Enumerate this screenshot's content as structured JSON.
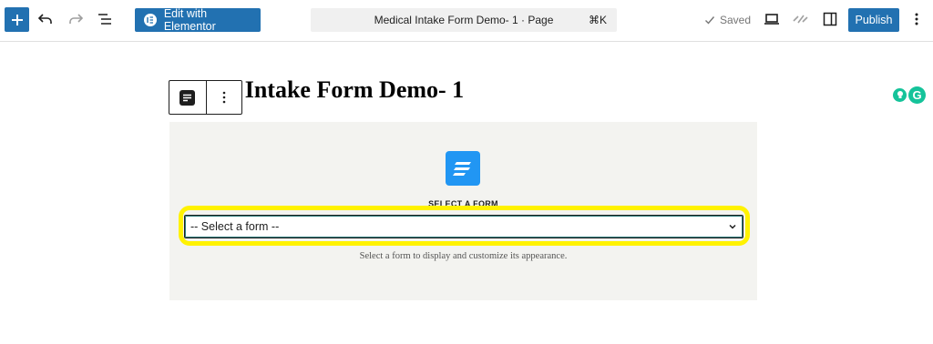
{
  "toolbar": {
    "elementor_label": "Edit with Elementor",
    "document_title": "Medical Intake Form Demo- 1 · Page",
    "shortcut": "⌘K",
    "saved_label": "Saved",
    "publish_label": "Publish",
    "icons": [
      "plus-icon",
      "undo-icon",
      "redo-icon",
      "document-overview-icon",
      "elementor-icon",
      "desktop-preview-icon",
      "jetpack-icon",
      "settings-sidebar-icon",
      "more-options-icon"
    ]
  },
  "editor": {
    "post_title": "l Intake Form Demo- 1",
    "form_block": {
      "label": "SELECT A FORM",
      "select_value": "-- Select a form --",
      "help_text": "Select a form to display and customize its appearance."
    }
  },
  "colors": {
    "accent": "#2271b1",
    "highlight": "#fff200",
    "fluent_forms": "#2196f3",
    "grammarly": "#15c39a"
  }
}
